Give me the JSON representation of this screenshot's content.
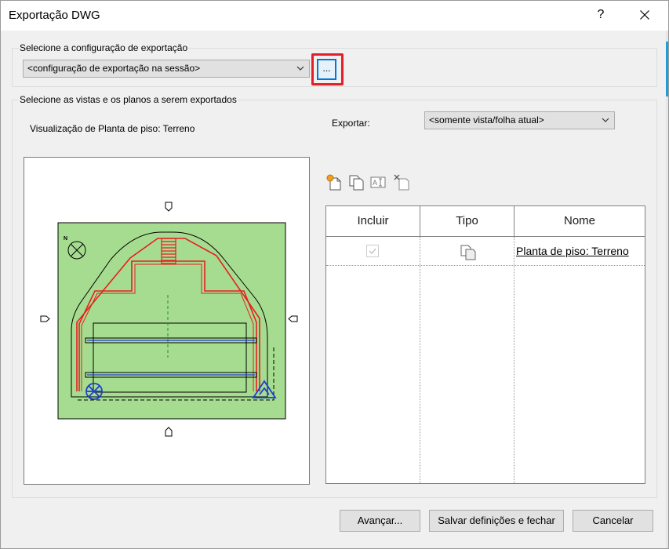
{
  "window": {
    "title": "Exportação DWG",
    "help_label": "?"
  },
  "config": {
    "group_label": "Selecione a configuração de exportação",
    "selected": "<configuração de exportação na sessão>",
    "dots_label": "..."
  },
  "views": {
    "group_label": "Selecione as vistas e os planos a serem exportados",
    "preview_label": "Visualização de Planta de piso: Terreno",
    "export_label": "Exportar:",
    "export_selected": "<somente vista/folha atual>",
    "north_label": "N"
  },
  "grid": {
    "columns": [
      "Incluir",
      "Tipo",
      "Nome"
    ],
    "rows": [
      {
        "include": true,
        "type_icon": "sheet-view-icon",
        "name": "Planta de piso: Terreno"
      }
    ]
  },
  "buttons": {
    "advanced": "Avançar...",
    "save_close": "Salvar definições e fechar",
    "cancel": "Cancelar"
  },
  "colors": {
    "highlight": "#e41e26",
    "focus_blue": "#0078d7",
    "site_green": "#a6dc90",
    "wall_red": "#e52020",
    "element_blue": "#1f3fd0"
  }
}
